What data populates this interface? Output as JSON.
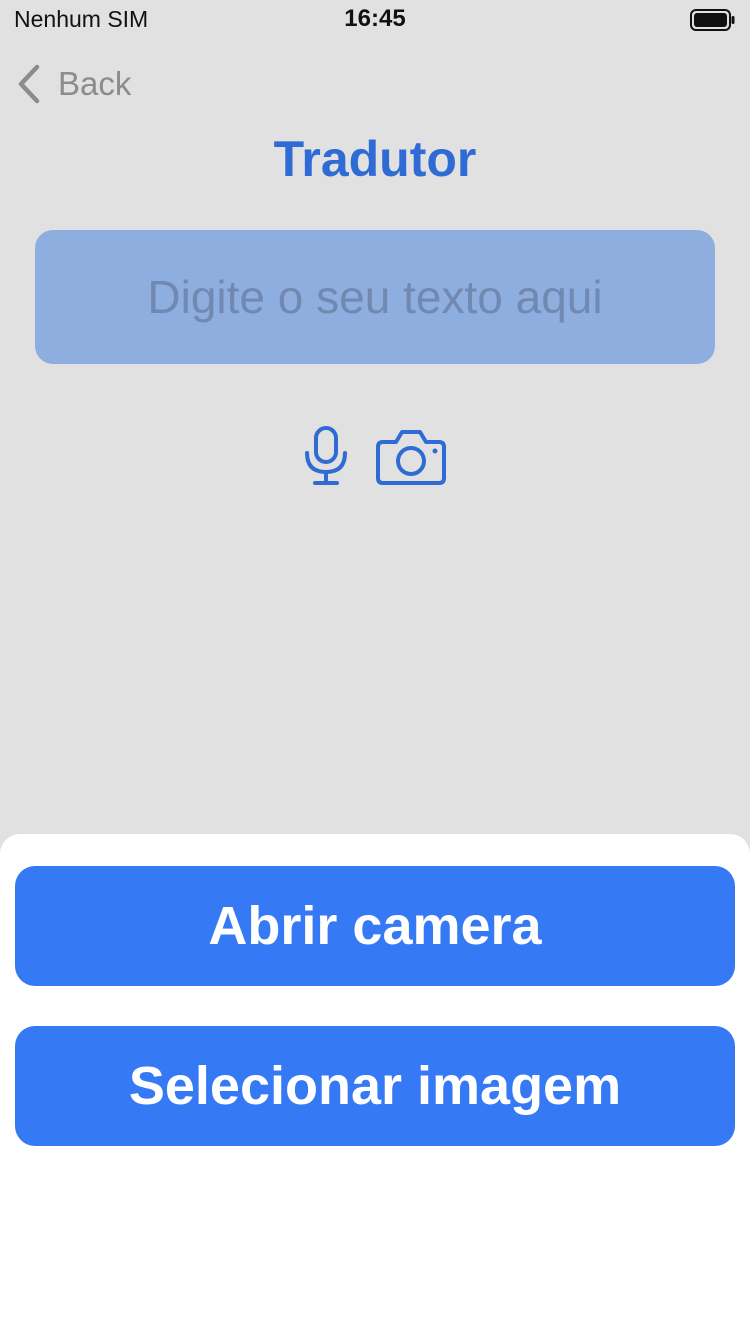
{
  "status_bar": {
    "carrier": "Nenhum SIM",
    "time": "16:45",
    "battery_icon": "battery-full-icon"
  },
  "nav": {
    "back_label": "Back",
    "back_icon": "chevron-left-icon",
    "title": "Tradutor"
  },
  "input": {
    "value": "",
    "placeholder": "Digite o seu texto aqui"
  },
  "actions": {
    "mic_icon": "microphone-icon",
    "camera_icon": "camera-icon"
  },
  "sheet": {
    "open_camera_label": "Abrir camera",
    "select_image_label": "Selecionar imagem"
  },
  "colors": {
    "background": "#e1e1e1",
    "accent": "#2f6bd4",
    "input_background": "#8eaee0",
    "button_background": "#3679f5",
    "back_gray": "#8c8c8c",
    "sheet_background": "#ffffff"
  }
}
